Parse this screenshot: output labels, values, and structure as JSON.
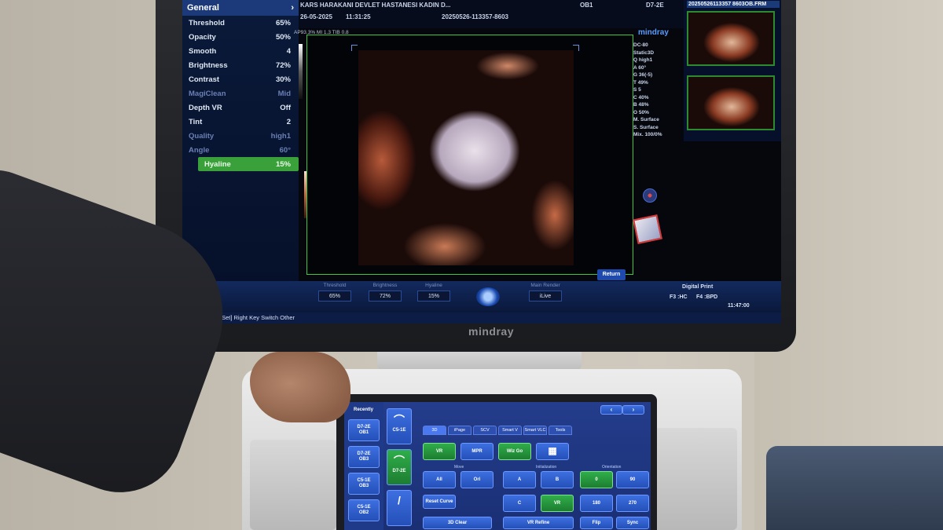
{
  "monitor_brand": "mindray",
  "screen": {
    "panel": {
      "title": "General",
      "params": [
        {
          "label": "Threshold",
          "value": "65%",
          "state": "normal"
        },
        {
          "label": "Opacity",
          "value": "50%",
          "state": "normal"
        },
        {
          "label": "Smooth",
          "value": "4",
          "state": "normal"
        },
        {
          "label": "Brightness",
          "value": "72%",
          "state": "normal"
        },
        {
          "label": "Contrast",
          "value": "30%",
          "state": "normal"
        },
        {
          "label": "MagiClean",
          "value": "Mid",
          "state": "dim"
        },
        {
          "label": "Depth VR",
          "value": "Off",
          "state": "normal"
        },
        {
          "label": "Tint",
          "value": "2",
          "state": "normal"
        },
        {
          "label": "Quality",
          "value": "high1",
          "state": "dim"
        },
        {
          "label": "Angle",
          "value": "60°",
          "state": "dim"
        },
        {
          "label": "Hyaline",
          "value": "15%",
          "state": "selected"
        }
      ]
    },
    "top": {
      "hospital": "KARS HARAKANI DEVLET HASTANESI KADIN D...",
      "date": "26-05-2025",
      "time": "11:31:25",
      "exam_id": "20250526-113357-8603",
      "preset": "OB1",
      "probe": "D7-2E",
      "image_params": "AP93.3% MI 1.3 TIB 0.8"
    },
    "brand": "mindray",
    "stats": [
      "DC-80",
      "Static3D",
      "Q high1",
      "A 60°",
      "G 36(-5)",
      "T 49%",
      "S 5",
      "C 40%",
      "B 48%",
      "O 50%",
      "M. Surface",
      "S. Surface",
      "Mix. 100/0%"
    ],
    "thumbnail_title": "20250526113357 8603OB.FRM",
    "return_label": "Return",
    "controls": [
      {
        "label": "Threshold",
        "value": "65%"
      },
      {
        "label": "Brightness",
        "value": "72%"
      },
      {
        "label": "Hyaline",
        "value": "15%"
      },
      {
        "label": "Main Render",
        "value": "iLive"
      }
    ],
    "sys": {
      "digital_print": "Digital Print",
      "f3": "F3 :HC",
      "f4": "F4 :BPD",
      "clock": "11:47:00"
    },
    "status": "[Set] Right Key Switch Other"
  },
  "touch": {
    "recently": "Recently",
    "presets": [
      {
        "line1": "D7-2E",
        "line2": "OB1"
      },
      {
        "line1": "D7-2E",
        "line2": "OB3"
      },
      {
        "line1": "C5-1E",
        "line2": "OB3"
      },
      {
        "line1": "C5-1E",
        "line2": "OB2"
      }
    ],
    "probes": [
      "C5-1E",
      "D7-2E",
      ""
    ],
    "tabs": [
      "3D",
      "iPage",
      "SCV",
      "Smart V",
      "Smart VLC",
      "Tools"
    ],
    "buttons": {
      "vr": "VR",
      "mpr": "MPR",
      "wiz": "Wiz Go",
      "all": "All",
      "ori": "Ori",
      "a": "A",
      "b": "B",
      "zero": "0",
      "ninety": "90",
      "c": "C",
      "vr2": "VR",
      "one_eighty": "180",
      "two_seventy": "270",
      "reset_curve": "Reset Curve",
      "flip": "Flip",
      "sync": "Sync",
      "clear": "3D Clear",
      "vr_dir": "VR Refine"
    },
    "captions": {
      "sec1": "Move",
      "sec2": "Initialization",
      "sec3": "Orientation"
    }
  }
}
